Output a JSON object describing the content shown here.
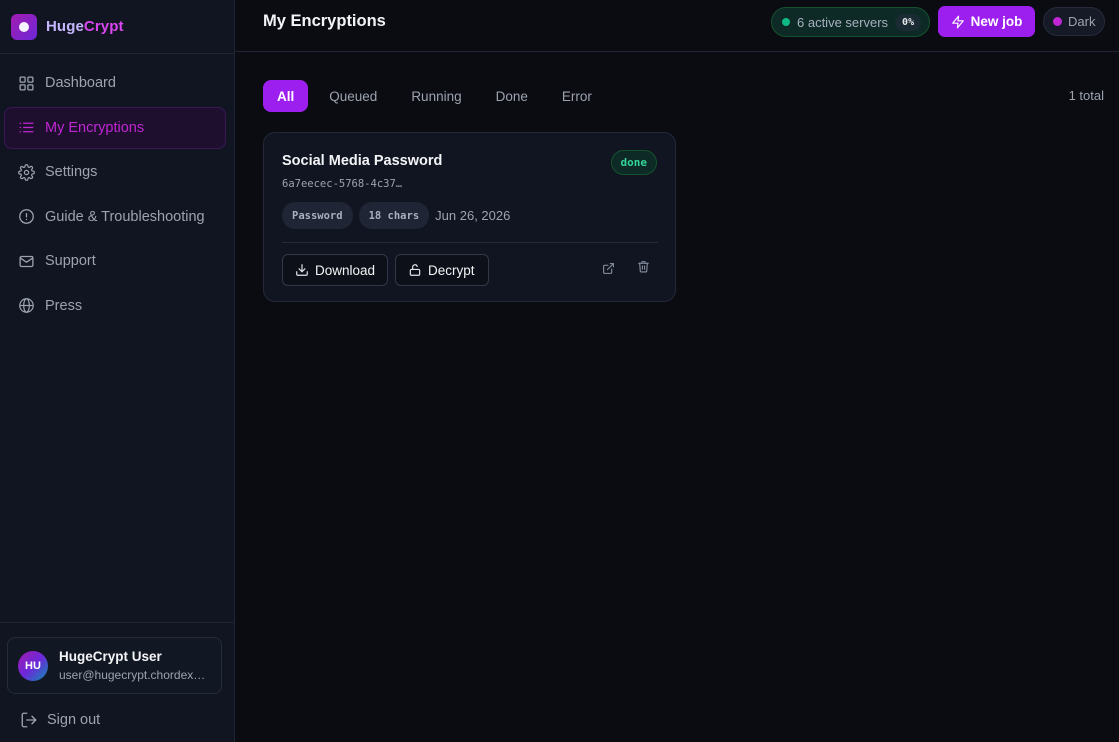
{
  "brand": {
    "part1": "Huge",
    "part2": "Crypt"
  },
  "sidebar": {
    "items": [
      {
        "label": "Dashboard",
        "icon": "grid-icon",
        "active": false
      },
      {
        "label": "My Encryptions",
        "icon": "list-icon",
        "active": true
      },
      {
        "label": "Settings",
        "icon": "gear-icon",
        "active": false
      },
      {
        "label": "Guide & Troubleshooting",
        "icon": "info-circle-icon",
        "active": false
      },
      {
        "label": "Support",
        "icon": "mail-icon",
        "active": false
      },
      {
        "label": "Press",
        "icon": "globe-icon",
        "active": false
      }
    ]
  },
  "user": {
    "initials": "HU",
    "name": "HugeCrypt User",
    "email": "user@hugecrypt.chordexb…"
  },
  "signout_label": "Sign out",
  "header": {
    "title": "My Encryptions",
    "servers_label": "6 active servers",
    "servers_pct": "0%",
    "new_job_label": "New job",
    "theme_label": "Dark"
  },
  "tabs": [
    {
      "label": "All",
      "active": true
    },
    {
      "label": "Queued",
      "active": false
    },
    {
      "label": "Running",
      "active": false
    },
    {
      "label": "Done",
      "active": false
    },
    {
      "label": "Error",
      "active": false
    }
  ],
  "total_label": "1 total",
  "jobs": [
    {
      "title": "Social Media Password",
      "id": "6a7eecec-5768-4c37…",
      "status": "done",
      "type_chip": "Password",
      "length_chip": "18 chars",
      "date": "Jun 26, 2026",
      "download_label": "Download",
      "decrypt_label": "Decrypt"
    }
  ],
  "colors": {
    "accent": "#9d1ff0",
    "active_nav": "#c026d3",
    "success": "#10b981",
    "background": "#0b0c12",
    "sidebar": "#111521"
  }
}
